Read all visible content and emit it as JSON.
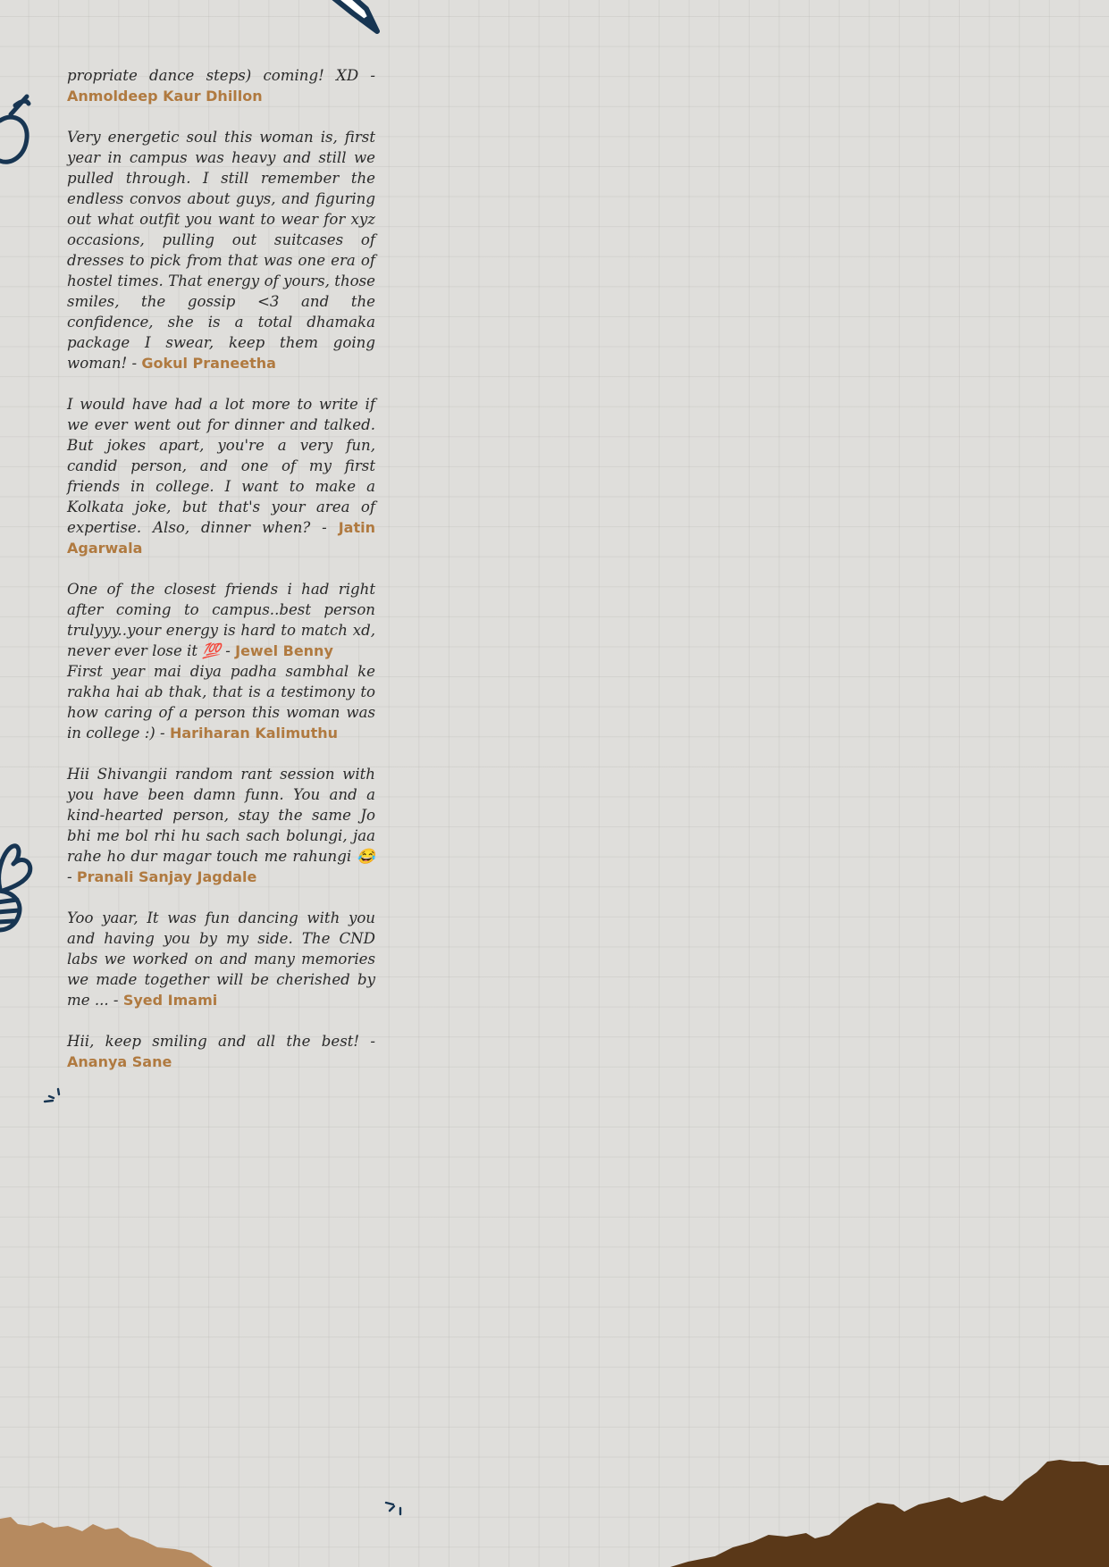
{
  "palette": {
    "background": "#dfdedb",
    "text": "#2a2a2a",
    "author": "#b07a40",
    "doodle": "#173552",
    "mountain_light": "#b68a5f",
    "mountain_dark": "#5a3818"
  },
  "decorations": [
    "pencil-doodle",
    "apple-doodle",
    "flower-doodle",
    "spark-doodle",
    "mountain-left",
    "mountain-right"
  ],
  "messages": [
    {
      "text": "propriate dance steps) coming! XD -",
      "author": "Anmoldeep Kaur Dhillon"
    },
    {
      "text": "Very energetic soul this woman is, first year in campus was heavy and still we pulled through. I still remember the endless convos about guys, and figuring out what outfit you want to wear for xyz occasions, pulling out suitcases of dresses to pick from that was one era of hostel times. That energy of yours, those smiles, the gossip <3 and the confidence, she is a total dhamaka package I swear, keep them going woman! -",
      "author": "Gokul Praneetha"
    },
    {
      "text": "I would have had a lot more to write if we ever went out for dinner and talked. But jokes apart, you're a very fun, candid person, and one of my first friends in college. I want to make a Kolkata joke, but that's your area of expertise. Also, dinner when? -",
      "author": "Jatin Agarwala"
    },
    {
      "text": "One of the closest friends i had right after coming to campus..best person trulyyy..your energy is hard to match xd, never ever lose it 💯 -",
      "author": "Jewel Benny"
    },
    {
      "text": "First year mai diya padha sambhal ke rakha hai ab thak, that is a testimony to how caring of a person this woman was in college :) -",
      "author": "Hariharan Kalimuthu"
    },
    {
      "text": "Hii Shivangii random rant session with you have been damn funn. You and a kind-hearted person, stay the same Jo bhi me bol rhi hu sach sach bolungi, jaa rahe ho dur magar touch me rahungi 😂 -",
      "author": "Pranali Sanjay Jagdale"
    },
    {
      "text": "Yoo yaar, It was fun dancing with you and having you by my side. The CND labs we worked on and many memories we made together will be cherished by me ... -",
      "author": "Syed Imami"
    },
    {
      "text": "Hii, keep smiling and all the best! -",
      "author": "Ananya Sane"
    }
  ]
}
